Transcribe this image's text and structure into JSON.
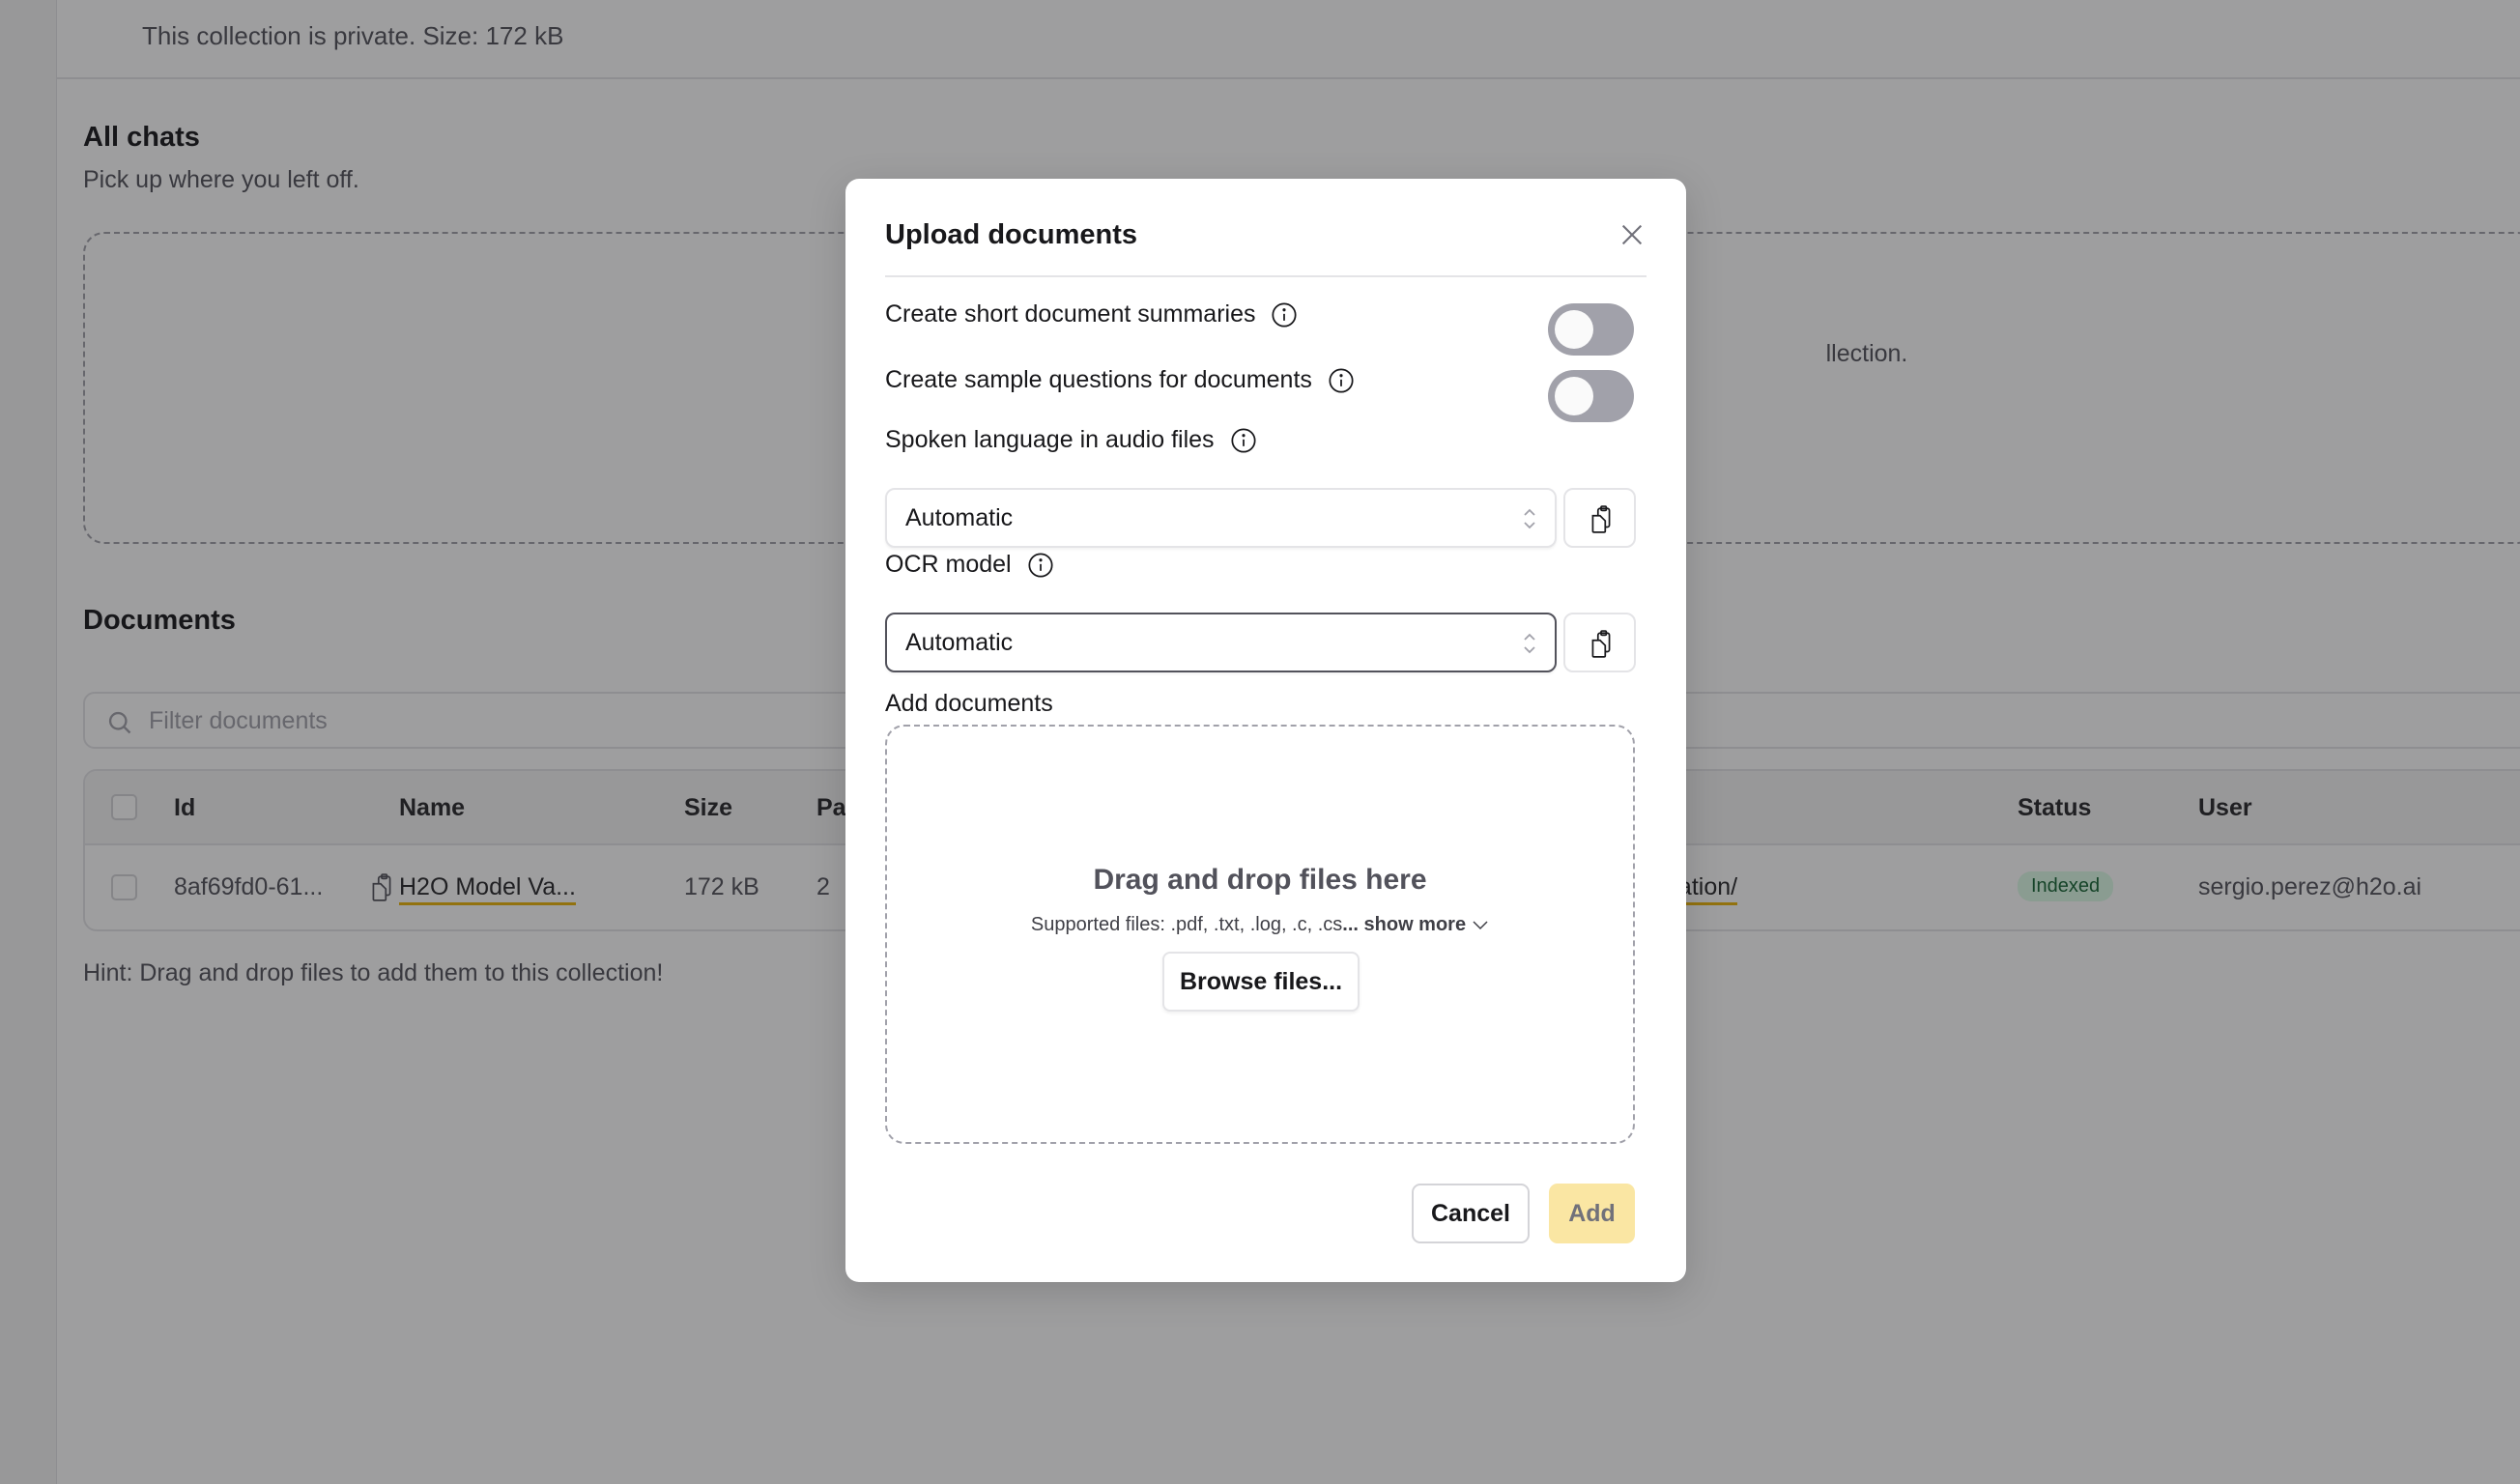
{
  "topbar": {
    "collection_info": "This collection is private. Size: 172 kB"
  },
  "chats": {
    "title": "All chats",
    "subtitle": "Pick up where you left off.",
    "empty_text_visible": "llection."
  },
  "documents": {
    "title": "Documents",
    "filter_placeholder": "Filter documents",
    "columns": [
      "Id",
      "Name",
      "Size",
      "Pa",
      "Status",
      "User"
    ],
    "rows": [
      {
        "id": "8af69fd0-61...",
        "name": "H2O Model Va...",
        "size": "172 kB",
        "pages": "2",
        "path_visible": "alidation/",
        "status": "Indexed",
        "user": "sergio.perez@h2o.ai"
      }
    ],
    "hint": "Hint: Drag and drop files to add them to this collection!"
  },
  "modal": {
    "title": "Upload documents",
    "options": {
      "summaries_label": "Create short document summaries",
      "summaries_enabled": false,
      "questions_label": "Create sample questions for documents",
      "questions_enabled": false,
      "language_label": "Spoken language in audio files",
      "language_value": "Automatic",
      "ocr_label": "OCR model",
      "ocr_value": "Automatic"
    },
    "add_documents_label": "Add documents",
    "dropzone": {
      "title": "Drag and drop files here",
      "supported_prefix": "Supported files: .pdf, .txt, .log, .c, .cs",
      "ellipsis": "...",
      "show_more": "show more",
      "browse_label": "Browse files..."
    },
    "cancel_label": "Cancel",
    "add_label": "Add"
  },
  "colors": {
    "accent_underline": "#eab308",
    "add_button_disabled": "#fae6a3",
    "status_indexed_bg": "#dcfce7",
    "status_indexed_text": "#166534",
    "toggle_off": "#a1a1aa"
  }
}
